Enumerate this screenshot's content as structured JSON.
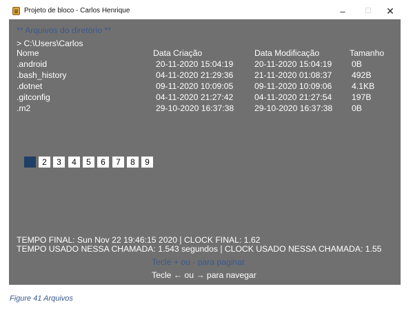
{
  "window": {
    "title": "Projeto de bloco - Carlos Henrique",
    "minimize_glyph": "–",
    "maximize_glyph": "☐",
    "close_glyph": "✕",
    "icon": "notepad-icon"
  },
  "console": {
    "heading": "** Arquivos do diretório **",
    "path": "> C:\\Users\\Carlos",
    "columns": {
      "name": "Nome",
      "created": "Data Criação",
      "modified": "Data Modificação",
      "size": "Tamanho"
    },
    "rows": [
      {
        "name": ".android",
        "created": "20-11-2020 15:04:19",
        "modified": "20-11-2020 15:04:19",
        "size": "0B"
      },
      {
        "name": ".bash_history",
        "created": "04-11-2020 21:29:36",
        "modified": "21-11-2020 01:08:37",
        "size": "492B"
      },
      {
        "name": ".dotnet",
        "created": "09-11-2020 10:09:05",
        "modified": "09-11-2020 10:09:06",
        "size": "4.1KB"
      },
      {
        "name": ".gitconfig",
        "created": "04-11-2020 21:27:42",
        "modified": "04-11-2020 21:27:54",
        "size": "197B"
      },
      {
        "name": ".m2",
        "created": "29-10-2020 16:37:38",
        "modified": "29-10-2020 16:37:38",
        "size": "0B"
      }
    ],
    "pages": [
      "1",
      "2",
      "3",
      "4",
      "5",
      "6",
      "7",
      "8",
      "9"
    ],
    "current_page": "1",
    "status_line_1": "TEMPO FINAL: Sun Nov 22 19:46:15 2020 | CLOCK FINAL: 1.62",
    "status_line_2": "TEMPO USADO NESSA CHAMADA: 1.543 segundos | CLOCK USADO NESSA CHAMADA: 1.55",
    "hint_paginate": "Tecle + ou - para paginar",
    "hint_navigate": "Tecle ← ou → para navegar"
  },
  "caption": "Figure 41 Arquivos",
  "colors": {
    "console_bg": "#707070",
    "blue_text": "#3a5a8c",
    "active_page": "#1f3f66"
  }
}
